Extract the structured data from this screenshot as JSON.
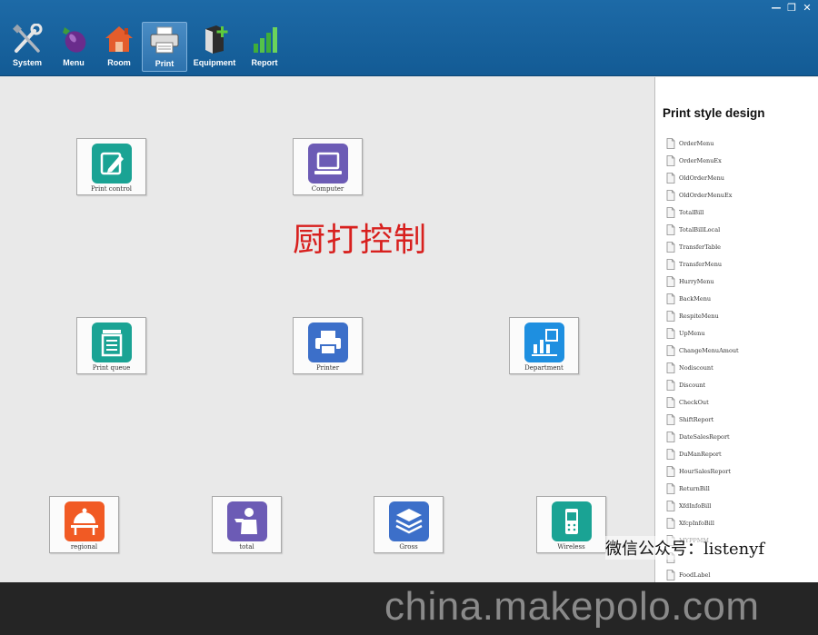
{
  "window": {
    "controls": [
      "—",
      "❐",
      "✕"
    ]
  },
  "toolbar": {
    "buttons": [
      {
        "label": "System",
        "icon": "tools-icon"
      },
      {
        "label": "Menu",
        "icon": "eggplant-icon"
      },
      {
        "label": "Room",
        "icon": "house-icon"
      },
      {
        "label": "Print",
        "icon": "printer-icon",
        "active": true
      },
      {
        "label": "Equipment",
        "icon": "server-add-icon"
      },
      {
        "label": "Report",
        "icon": "bar-chart-icon"
      }
    ]
  },
  "main": {
    "title": "厨打控制",
    "tiles": [
      {
        "label": "Print control",
        "icon": "edit-icon",
        "color": "#1aa394"
      },
      {
        "label": "Computer",
        "icon": "computer-icon",
        "color": "#6c5bb5"
      },
      {
        "label": "Print queue",
        "icon": "document-list-icon",
        "color": "#1aa394"
      },
      {
        "label": "Printer",
        "icon": "printer-icon",
        "color": "#3c6fc9"
      },
      {
        "label": "Department",
        "icon": "department-chart-icon",
        "color": "#1e8fe0"
      },
      {
        "label": "regional",
        "icon": "cloche-icon",
        "color": "#f15a24"
      },
      {
        "label": "total",
        "icon": "waiter-icon",
        "color": "#6c5bb5"
      },
      {
        "label": "Gross",
        "icon": "layers-icon",
        "color": "#3c6fc9"
      },
      {
        "label": "Wireless",
        "icon": "mobile-phone-icon",
        "color": "#1aa394"
      }
    ]
  },
  "panel": {
    "title": "Print style design",
    "items": [
      "OrderMenu",
      "OrderMenuEx",
      "OldOrderMenu",
      "OldOrderMenuEx",
      "TotalBill",
      "TotalBillLocal",
      "TransferTable",
      "TransferMenu",
      "HurryMenu",
      "BackMenu",
      "RespiteMenu",
      "UpMenu",
      "ChangeMenuAmout",
      "Nodiscount",
      "Discount",
      "CheckOut",
      "ShiftReport",
      "DateSalesReport",
      "DuManReport",
      "HourSalesReport",
      "ReturnBill",
      "XfdInfoBill",
      "XfcpInfoBill",
      "MYPPMM",
      "",
      "FoodLabel"
    ]
  },
  "watermark": {
    "wechat": "微信公众号：listenyf"
  },
  "banner": {
    "text": "china.makepolo.com"
  }
}
